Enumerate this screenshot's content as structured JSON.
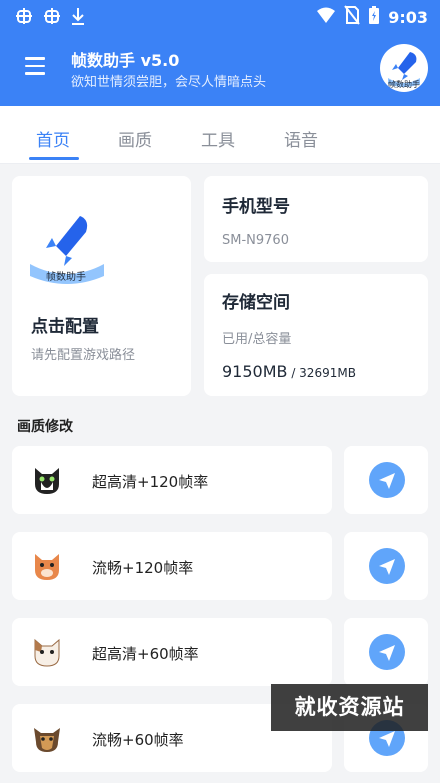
{
  "status_bar": {
    "time": "9:03"
  },
  "app": {
    "title": "帧数助手 v5.0",
    "subtitle": "欲知世情须尝胆，会尽人情暗点头",
    "logo_text": "帧数助手"
  },
  "tabs": [
    {
      "label": "首页",
      "active": true
    },
    {
      "label": "画质",
      "active": false
    },
    {
      "label": "工具",
      "active": false
    },
    {
      "label": "语音",
      "active": false
    }
  ],
  "config_card": {
    "title": "点击配置",
    "subtitle": "请先配置游戏路径"
  },
  "device_card": {
    "title": "手机型号",
    "model": "SM-N9760"
  },
  "storage_card": {
    "title": "存储空间",
    "subtitle": "已用/总容量",
    "used": "9150MB",
    "separator": " / ",
    "total": "32691MB"
  },
  "section_title": "画质修改",
  "quality_options": [
    {
      "label": "超高清+120帧率",
      "icon": "black-white-cat-icon"
    },
    {
      "label": "流畅+120帧率",
      "icon": "orange-cat-icon"
    },
    {
      "label": "超高清+60帧率",
      "icon": "calico-cat-icon"
    },
    {
      "label": "流畅+60帧率",
      "icon": "yorkie-dog-icon"
    }
  ],
  "watermark": "就收资源站",
  "colors": {
    "primary": "#3b82f6",
    "accent": "#60a5fa",
    "background": "#f3f4f6"
  }
}
